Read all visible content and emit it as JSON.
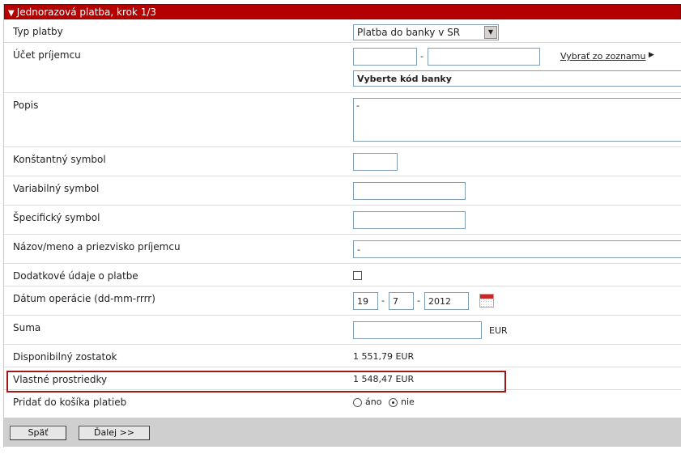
{
  "header": {
    "title": "Jednorazová platba, krok 1/3",
    "arrow": "▼"
  },
  "rows": {
    "typ_platby": {
      "label": "Typ platby",
      "value": "Platba do banky v SR"
    },
    "ucet": {
      "label": "Účet príjemcu",
      "prefix": "",
      "number": "",
      "dash": "-",
      "link": "Vybrať zo zoznamu",
      "link_arrow": "▶",
      "bank_select": "Vyberte kód banky"
    },
    "popis": {
      "label": "Popis",
      "value": "-"
    },
    "konst": {
      "label": "Konštantný symbol",
      "value": ""
    },
    "var": {
      "label": "Variabilný symbol",
      "value": ""
    },
    "spec": {
      "label": "Špecifický symbol",
      "value": ""
    },
    "nazov": {
      "label": "Názov/meno a priezvisko príjemcu",
      "value": "-"
    },
    "dodatkove": {
      "label": "Dodatkové údaje o platbe",
      "checked": false
    },
    "datum": {
      "label": "Dátum operácie (dd-mm-rrrr)",
      "day": "19",
      "month": "7",
      "year": "2012",
      "sep": "-"
    },
    "suma": {
      "label": "Suma",
      "value": "",
      "currency": "EUR"
    },
    "disponibilny": {
      "label": "Disponibilný zostatok",
      "value": "1 551,79 EUR"
    },
    "vlastne": {
      "label": "Vlastné prostriedky",
      "value": "1 548,47 EUR"
    },
    "pridat": {
      "label": "Pridať do košíka platieb",
      "opt_yes": "áno",
      "opt_no": "nie",
      "selected": "nie"
    }
  },
  "buttons": {
    "back": "Späť",
    "next": "Ďalej >>"
  }
}
